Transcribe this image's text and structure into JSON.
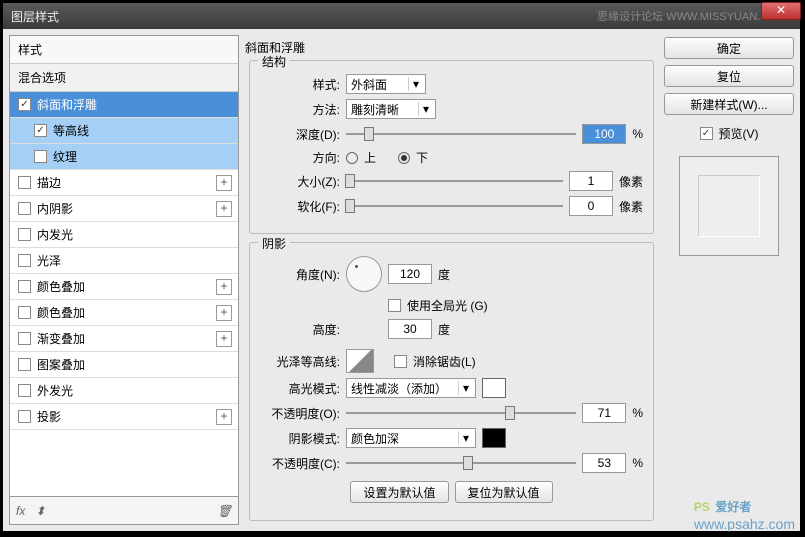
{
  "titlebar": {
    "title": "图层样式",
    "watermark": "思缘设计论坛  WWW.MISSYUAN.COM",
    "close": "✕"
  },
  "left": {
    "styles_header": "样式",
    "blend_header": "混合选项",
    "items": [
      {
        "label": "斜面和浮雕",
        "checked": true,
        "selected": true
      },
      {
        "label": "等高线",
        "checked": true,
        "sub": true
      },
      {
        "label": "纹理",
        "checked": false,
        "sub": true
      },
      {
        "label": "描边",
        "checked": false,
        "plus": true
      },
      {
        "label": "内阴影",
        "checked": false,
        "plus": true
      },
      {
        "label": "内发光",
        "checked": false
      },
      {
        "label": "光泽",
        "checked": false
      },
      {
        "label": "颜色叠加",
        "checked": false,
        "plus": true
      },
      {
        "label": "颜色叠加",
        "checked": false,
        "plus": true
      },
      {
        "label": "渐变叠加",
        "checked": false,
        "plus": true
      },
      {
        "label": "图案叠加",
        "checked": false
      },
      {
        "label": "外发光",
        "checked": false
      },
      {
        "label": "投影",
        "checked": false,
        "plus": true
      }
    ],
    "bottom": {
      "fx": "fx",
      "arrows": "⬍"
    }
  },
  "center": {
    "section_title": "斜面和浮雕",
    "structure": {
      "legend": "结构",
      "style_label": "样式:",
      "style_value": "外斜面",
      "method_label": "方法:",
      "method_value": "雕刻清晰",
      "depth_label": "深度(D):",
      "depth_value": "100",
      "depth_unit": "%",
      "direction_label": "方向:",
      "up": "上",
      "down": "下",
      "size_label": "大小(Z):",
      "size_value": "1",
      "size_unit": "像素",
      "soften_label": "软化(F):",
      "soften_value": "0",
      "soften_unit": "像素"
    },
    "shadow": {
      "legend": "阴影",
      "angle_label": "角度(N):",
      "angle_value": "120",
      "angle_unit": "度",
      "global_label": "使用全局光 (G)",
      "altitude_label": "高度:",
      "altitude_value": "30",
      "altitude_unit": "度",
      "gloss_label": "光泽等高线:",
      "antialias_label": "消除锯齿(L)",
      "highlight_mode_label": "高光模式:",
      "highlight_mode_value": "线性减淡（添加）",
      "highlight_opacity_label": "不透明度(O):",
      "highlight_opacity_value": "71",
      "percent": "%",
      "shadow_mode_label": "阴影模式:",
      "shadow_mode_value": "颜色加深",
      "shadow_opacity_label": "不透明度(C):",
      "shadow_opacity_value": "53"
    },
    "buttons": {
      "make_default": "设置为默认值",
      "reset_default": "复位为默认值"
    }
  },
  "right": {
    "ok": "确定",
    "cancel": "复位",
    "new_style": "新建样式(W)...",
    "preview_label": "预览(V)"
  },
  "watermark_logo": {
    "ps": "PS",
    "name": "爱好者",
    "url": "www.psahz.com"
  }
}
